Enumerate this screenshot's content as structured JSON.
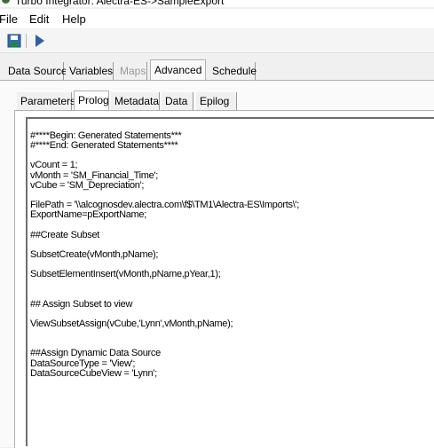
{
  "window": {
    "title": "Turbo Integrator:  Alectra-ES->SampleExport"
  },
  "menu": {
    "file": "File",
    "edit": "Edit",
    "help": "Help"
  },
  "toolbar": {
    "save_icon": "save-icon",
    "run_icon": "run-icon"
  },
  "outer_tabs": [
    {
      "label": "Data Source",
      "state": "normal"
    },
    {
      "label": "Variables",
      "state": "normal"
    },
    {
      "label": "Maps",
      "state": "disabled"
    },
    {
      "label": "Advanced",
      "state": "active"
    },
    {
      "label": "Schedule",
      "state": "normal"
    }
  ],
  "inner_tabs": [
    {
      "label": "Parameters",
      "state": "normal"
    },
    {
      "label": "Prolog",
      "state": "active"
    },
    {
      "label": "Metadata",
      "state": "normal"
    },
    {
      "label": "Data",
      "state": "normal"
    },
    {
      "label": "Epilog",
      "state": "normal"
    }
  ],
  "editor": {
    "code": "#****Begin: Generated Statements***\n#****End: Generated Statements****\n\nvCount = 1;\nvMonth = 'SM_Financial_Time';\nvCube = 'SM_Depreciation';\n\nFilePath = '\\\\alcognosdev.alectra.com\\f$\\TM1\\Alectra-ES\\Imports\\';\nExportName=pExportName;\n\n##Create Subset\n\nSubsetCreate(vMonth,pName);\n\nSubsetElementInsert(vMonth,pName,pYear,1);\n\n\n## Assign Subset to view\n\nViewSubsetAssign(vCube,'Lynn',vMonth,pName);\n\n\n##Assign Dynamic Data Source\nDataSourceType = 'View';\nDataSourceCubeView = 'Lynn';"
  }
}
